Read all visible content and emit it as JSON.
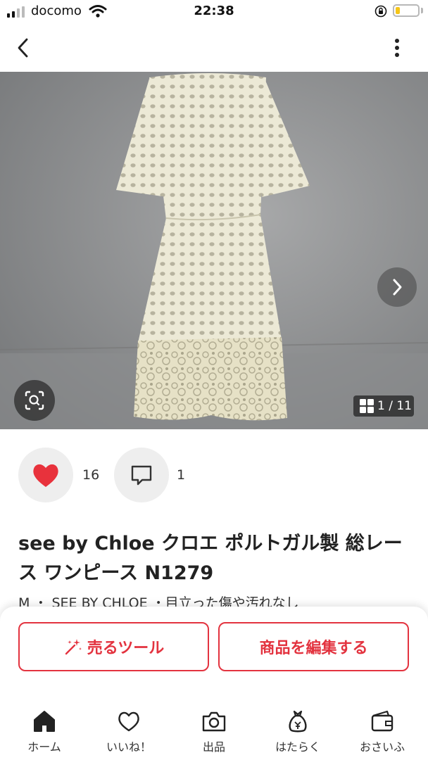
{
  "status_bar": {
    "carrier": "docomo",
    "time": "22:38",
    "battery_level": 0.2
  },
  "product": {
    "image_counter": "1 / 11",
    "likes": "16",
    "comments": "1",
    "title": "see by Chloe クロエ ポルトガル製 総レース ワンピース N1279",
    "meta": "M ・ SEE BY CHLOE ・目立った傷や汚れなし"
  },
  "actions": {
    "sell_tool_label": "売るツール",
    "edit_label": "商品を編集する"
  },
  "tabs": [
    {
      "label": "ホーム",
      "icon": "home-icon"
    },
    {
      "label": "いいね！",
      "icon": "heart-outline-icon"
    },
    {
      "label": "出品",
      "icon": "camera-icon"
    },
    {
      "label": "はたらく",
      "icon": "money-bag-icon"
    },
    {
      "label": "おさいふ",
      "icon": "wallet-icon"
    }
  ],
  "colors": {
    "accent": "#e3333f",
    "like_heart": "#e8323c"
  }
}
